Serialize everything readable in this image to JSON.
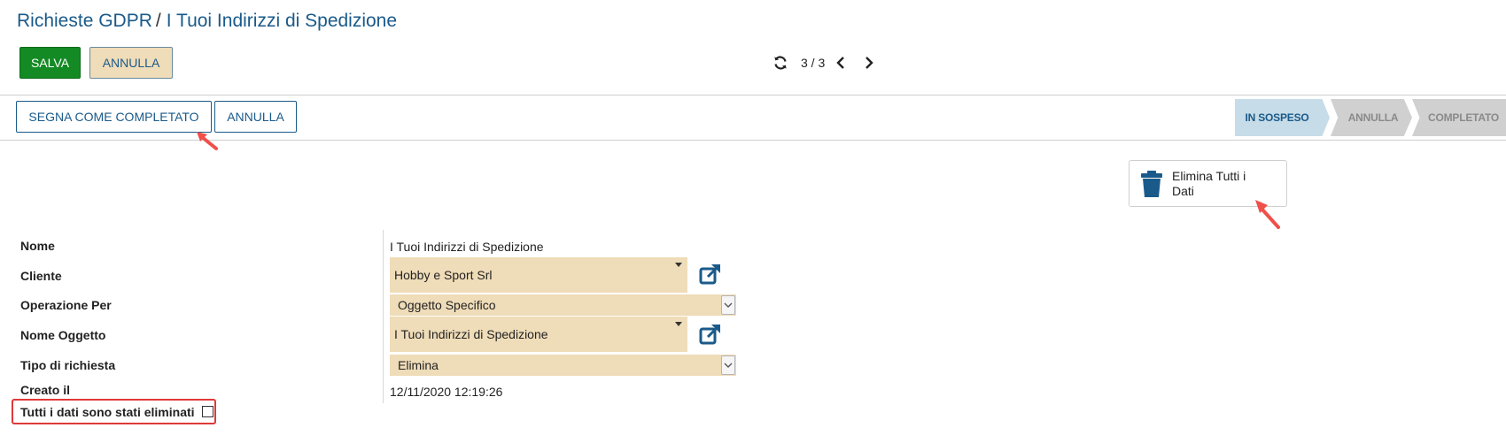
{
  "breadcrumb": {
    "parent": "Richieste GDPR",
    "separator": "/",
    "current": "I Tuoi Indirizzi di Spedizione"
  },
  "toolbar": {
    "save_label": "SALVA",
    "cancel_label": "ANNULLA"
  },
  "pager": {
    "counter": "3 / 3",
    "refresh_icon": "refresh-icon",
    "prev_icon": "chevron-left-icon",
    "next_icon": "chevron-right-icon"
  },
  "actions": {
    "mark_completed_label": "SEGNA COME COMPLETATO",
    "cancel_label": "ANNULLA"
  },
  "status_bar": {
    "stages": [
      {
        "label": "IN SOSPESO",
        "active": true
      },
      {
        "label": "ANNULLA",
        "active": false
      },
      {
        "label": "COMPLETATO",
        "active": false
      }
    ],
    "active_color": "#c6dce8",
    "inactive_color": "#d0d0d0"
  },
  "smart_button": {
    "label": "Elimina Tutti i Dati",
    "icon": "trash-icon"
  },
  "form": {
    "fields": {
      "name": {
        "label": "Nome",
        "value": "I Tuoi Indirizzi di Spedizione"
      },
      "customer": {
        "label": "Cliente",
        "value": "Hobby e Sport Srl"
      },
      "operation_for": {
        "label": "Operazione Per",
        "value": "Oggetto Specifico"
      },
      "object_name": {
        "label": "Nome Oggetto",
        "value": "I Tuoi Indirizzi di Spedizione"
      },
      "request_type": {
        "label": "Tipo di richiesta",
        "value": "Elimina"
      },
      "created_on": {
        "label": "Creato il",
        "value": "12/11/2020 12:19:26"
      },
      "all_deleted": {
        "label": "Tutti i dati sono stati eliminati",
        "checked": false
      }
    }
  },
  "colors": {
    "primary": "#1a5a8a",
    "save_green": "#138a24",
    "field_bg": "#efdcb8",
    "highlight_red": "#e03838"
  }
}
